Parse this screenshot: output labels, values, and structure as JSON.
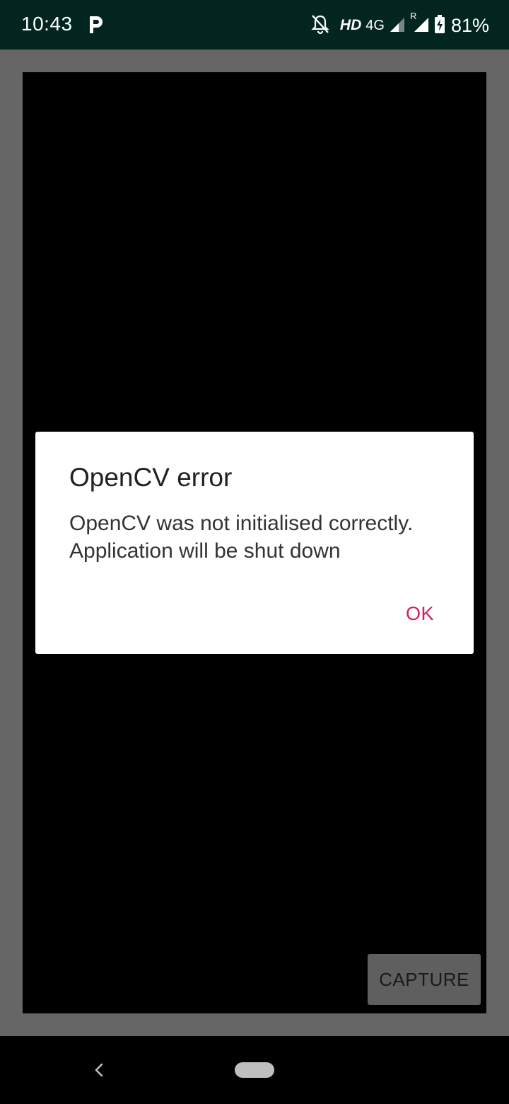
{
  "status_bar": {
    "time": "10:43",
    "hd": "HD",
    "network": "4G",
    "roaming": "R",
    "battery": "81%"
  },
  "camera": {
    "capture_label": "CAPTURE"
  },
  "dialog": {
    "title": "OpenCV error",
    "message": "OpenCV was not initialised correctly. Application will be shut down",
    "ok_label": "OK"
  },
  "colors": {
    "status_bar_bg": "#02261f",
    "accent": "#d81b60",
    "backdrop": "#666666"
  },
  "icons": {
    "status_left": "parking-app-icon",
    "status_right": [
      "notifications-off-icon",
      "signal-icon",
      "signal-roaming-icon",
      "battery-charging-icon"
    ],
    "nav": [
      "back-icon",
      "home-pill-icon"
    ]
  }
}
